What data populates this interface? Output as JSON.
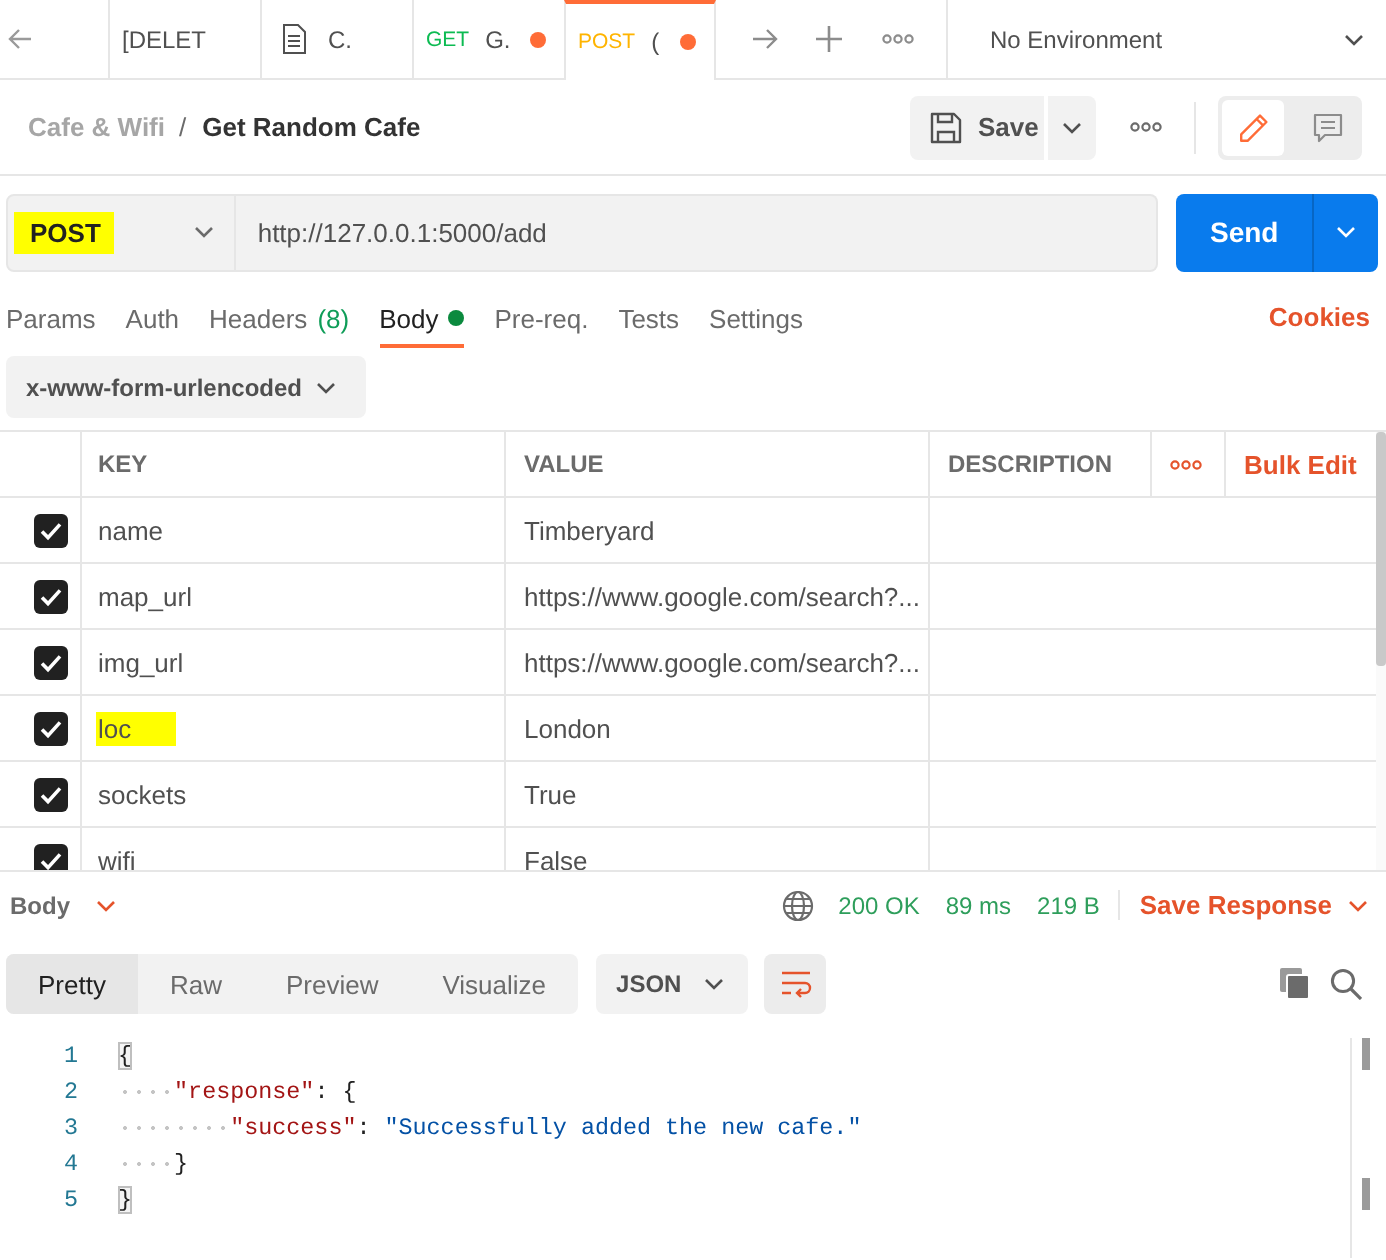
{
  "tab_bar": {
    "tabs": [
      {
        "kind": "plain",
        "label": "[DELET",
        "unsaved": false,
        "selected": false
      },
      {
        "kind": "document",
        "label": "C.",
        "unsaved": false,
        "selected": false
      },
      {
        "kind": "request",
        "method": "GET",
        "color": "#0cbb52",
        "label": "G.",
        "unsaved": true,
        "selected": false
      },
      {
        "kind": "request",
        "method": "POST",
        "color": "#ffb400",
        "label": "(",
        "unsaved": true,
        "selected": true
      }
    ],
    "environment": "No Environment"
  },
  "breadcrumb": {
    "collection": "Cafe & Wifi",
    "separator": "/",
    "request": "Get Random Cafe"
  },
  "toolbar": {
    "save": "Save",
    "panels": [
      {
        "kind": "edit",
        "selected": true
      },
      {
        "kind": "comments",
        "selected": false
      }
    ]
  },
  "request": {
    "method": "POST",
    "method_highlighted": true,
    "url": "http://127.0.0.1:5000/add",
    "send": "Send"
  },
  "request_tabs": [
    {
      "label": "Params",
      "selected": false
    },
    {
      "label": "Auth",
      "selected": false
    },
    {
      "label": "Headers",
      "count": "(8)",
      "selected": false
    },
    {
      "label": "Body",
      "has_content": true,
      "selected": true
    },
    {
      "label": "Pre-req.",
      "selected": false
    },
    {
      "label": "Tests",
      "selected": false
    },
    {
      "label": "Settings",
      "selected": false
    }
  ],
  "cookies": "Cookies",
  "body_type": "x-www-form-urlencoded",
  "table": {
    "columns": [
      "KEY",
      "VALUE",
      "DESCRIPTION"
    ],
    "bulk_edit": "Bulk Edit",
    "rows": [
      {
        "checked": true,
        "key": "name",
        "key_highlighted": false,
        "value": "Timberyard"
      },
      {
        "checked": true,
        "key": "map_url",
        "key_highlighted": false,
        "value": "https://www.google.com/search?..."
      },
      {
        "checked": true,
        "key": "img_url",
        "key_highlighted": false,
        "value": "https://www.google.com/search?..."
      },
      {
        "checked": true,
        "key": "loc",
        "key_highlighted": true,
        "value": "London"
      },
      {
        "checked": true,
        "key": "sockets",
        "key_highlighted": false,
        "value": "True"
      },
      {
        "checked": true,
        "key": "wifi",
        "key_highlighted": false,
        "value": "False"
      }
    ]
  },
  "response": {
    "section": "Body",
    "status": "200 OK",
    "time": "89 ms",
    "size": "219 B",
    "save": "Save Response",
    "views": [
      {
        "label": "Pretty",
        "selected": true
      },
      {
        "label": "Raw",
        "selected": false
      },
      {
        "label": "Preview",
        "selected": false
      },
      {
        "label": "Visualize",
        "selected": false
      }
    ],
    "format": "JSON",
    "wrap_lines": true,
    "lines": [
      {
        "number": "1",
        "tokens": [
          {
            "kind": "brace-match",
            "text": "{"
          }
        ]
      },
      {
        "number": "2",
        "tokens": [
          {
            "kind": "indent"
          },
          {
            "kind": "key",
            "text": "\"response\""
          },
          {
            "kind": "punct",
            "text": ": {"
          }
        ]
      },
      {
        "number": "3",
        "tokens": [
          {
            "kind": "indent"
          },
          {
            "kind": "indent"
          },
          {
            "kind": "key",
            "text": "\"success\""
          },
          {
            "kind": "punct",
            "text": ": "
          },
          {
            "kind": "string",
            "text": "\"Successfully added the new cafe.\""
          }
        ]
      },
      {
        "number": "4",
        "tokens": [
          {
            "kind": "indent"
          },
          {
            "kind": "punct",
            "text": "}"
          }
        ]
      },
      {
        "number": "5",
        "tokens": [
          {
            "kind": "brace-match",
            "text": "}"
          }
        ]
      }
    ]
  }
}
